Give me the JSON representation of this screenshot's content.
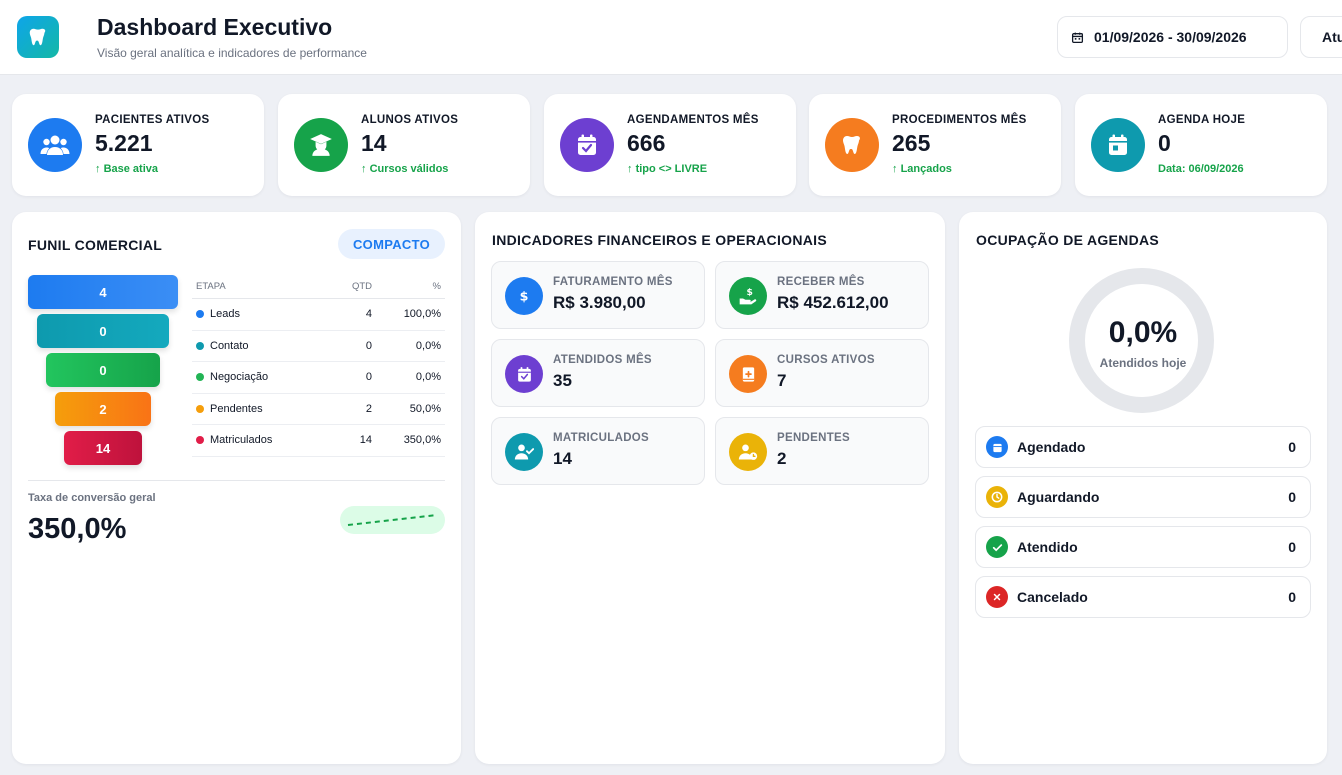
{
  "header": {
    "title": "Dashboard Executivo",
    "subtitle": "Visão geral analítica e indicadores de performance",
    "date_range": "01/09/2026 - 30/09/2026",
    "refresh_label": "Atualizar",
    "logo_icon": "tooth-icon"
  },
  "kpis": [
    {
      "label": "PACIENTES ATIVOS",
      "value": "5.221",
      "note": "Base ativa",
      "icon": "users-icon",
      "color": "#1d7bf0"
    },
    {
      "label": "ALUNOS ATIVOS",
      "value": "14",
      "note": "Cursos válidos",
      "icon": "graduate-icon",
      "color": "#16a34a"
    },
    {
      "label": "AGENDAMENTOS MÊS",
      "value": "666",
      "note": "tipo <> LIVRE",
      "icon": "calendar-check-icon",
      "color": "#6d3fd1"
    },
    {
      "label": "PROCEDIMENTOS MÊS",
      "value": "265",
      "note": "Lançados",
      "icon": "tooth-icon",
      "color": "#f57c1f"
    },
    {
      "label": "AGENDA HOJE",
      "value": "0",
      "note": "Data: 06/09/2026",
      "icon": "calendar-day-icon",
      "color": "#0e9aae"
    }
  ],
  "funnel": {
    "title": "FUNIL COMERCIAL",
    "mode": "COMPACTO",
    "headers": {
      "stage": "ETAPA",
      "qty": "QTD",
      "pct": "%"
    },
    "stages": [
      {
        "name": "Leads",
        "qty": "4",
        "pct": "100,0%",
        "color": "#1d7bf0"
      },
      {
        "name": "Contato",
        "qty": "0",
        "pct": "0,0%",
        "color": "#0e9aae"
      },
      {
        "name": "Negociação",
        "qty": "0",
        "pct": "0,0%",
        "color": "#22b455"
      },
      {
        "name": "Pendentes",
        "qty": "2",
        "pct": "50,0%",
        "color": "#f59e0b"
      },
      {
        "name": "Matriculados",
        "qty": "14",
        "pct": "350,0%",
        "color": "#e11d48"
      }
    ],
    "conversion_label": "Taxa de conversão geral",
    "conversion_value": "350,0%"
  },
  "indicators": {
    "title": "INDICADORES FINANCEIROS E OPERACIONAIS",
    "items": [
      {
        "label": "FATURAMENTO MÊS",
        "value": "R$ 3.980,00",
        "icon": "dollar-icon",
        "color": "#1d7bf0"
      },
      {
        "label": "RECEBER MÊS",
        "value": "R$ 452.612,00",
        "icon": "hand-money-icon",
        "color": "#16a34a"
      },
      {
        "label": "ATENDIDOS MÊS",
        "value": "35",
        "icon": "calendar-check-icon",
        "color": "#6d3fd1"
      },
      {
        "label": "CURSOS ATIVOS",
        "value": "7",
        "icon": "book-icon",
        "color": "#f57c1f"
      },
      {
        "label": "MATRICULADOS",
        "value": "14",
        "icon": "user-check-icon",
        "color": "#0e9aae"
      },
      {
        "label": "PENDENTES",
        "value": "2",
        "icon": "user-clock-icon",
        "color": "#eab308"
      }
    ]
  },
  "agenda": {
    "title": "OCUPAÇÃO DE AGENDAS",
    "occupancy": "0,0%",
    "occupancy_label": "Atendidos hoje",
    "statuses": [
      {
        "label": "Agendado",
        "count": "0",
        "icon": "calendar-icon",
        "color": "#1d7bf0"
      },
      {
        "label": "Aguardando",
        "count": "0",
        "icon": "clock-icon",
        "color": "#eab308"
      },
      {
        "label": "Atendido",
        "count": "0",
        "icon": "check-icon",
        "color": "#16a34a"
      },
      {
        "label": "Cancelado",
        "count": "0",
        "icon": "x-icon",
        "color": "#dc2626"
      }
    ]
  }
}
